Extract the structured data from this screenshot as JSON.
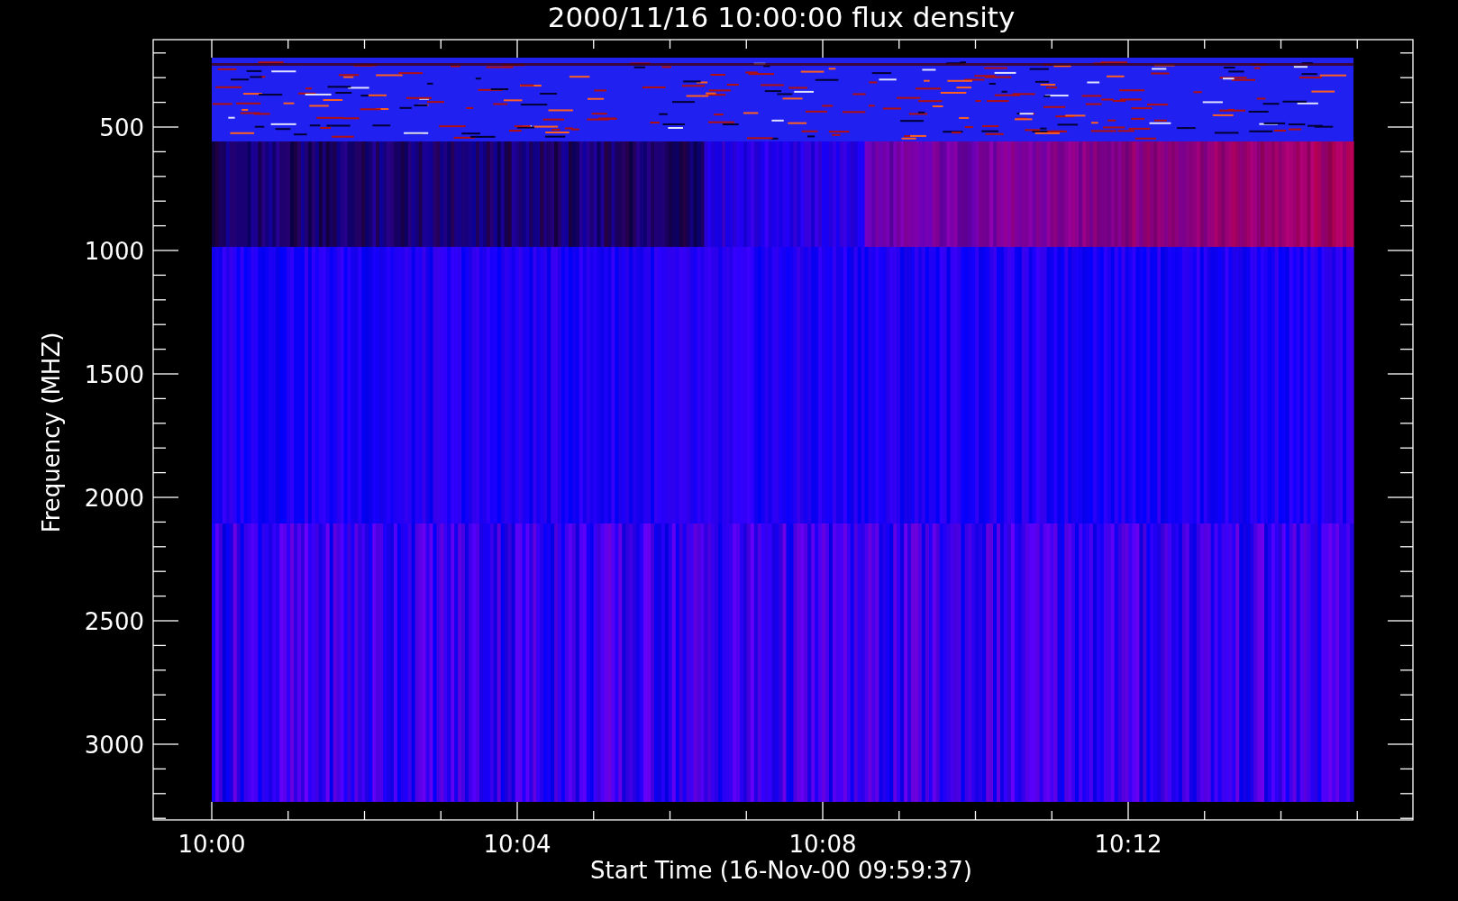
{
  "title": "2000/11/16 10:00:00 flux density",
  "plot": {
    "ylabel": "Frequency (MHZ)",
    "xlabel": "Start Time (16-Nov-00 09:59:37)",
    "yticks": [
      "500",
      "1000",
      "1500",
      "2000",
      "2500",
      "3000"
    ],
    "xticks": [
      "10:00",
      "10:04",
      "10:08",
      "10:12"
    ]
  }
}
